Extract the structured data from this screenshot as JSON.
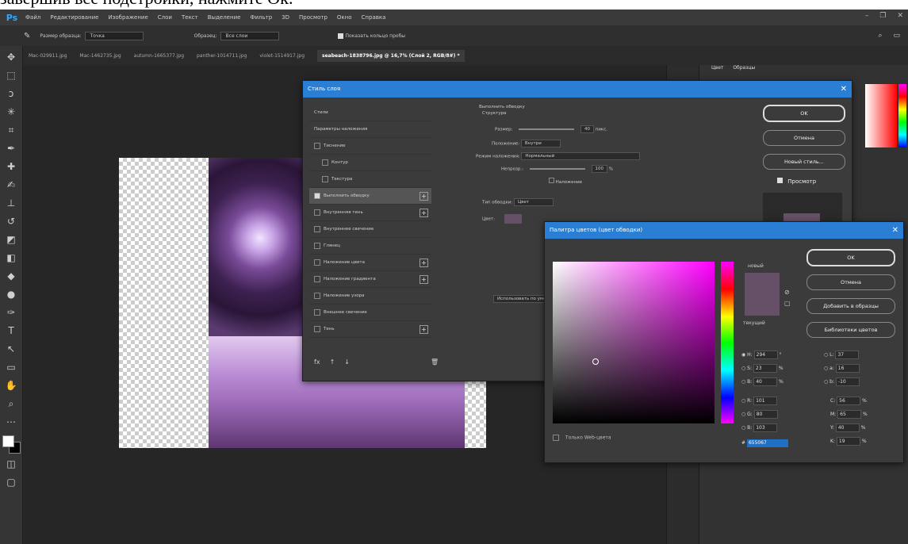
{
  "caption": {
    "text": "завершив все подстройки, нажмите Ok."
  },
  "app": {
    "logo": "Ps",
    "menu": [
      "Файл",
      "Редактирование",
      "Изображение",
      "Слои",
      "Текст",
      "Выделение",
      "Фильтр",
      "3D",
      "Просмотр",
      "Окно",
      "Справка"
    ]
  },
  "options": {
    "sample_label": "Размер образца:",
    "sample_value": "Точка",
    "sample_from_label": "Образец:",
    "sample_from_value": "Все слои",
    "show_ring": "Показать кольцо пробы"
  },
  "tabs": [
    {
      "label": "Mac-029911.jpg"
    },
    {
      "label": "Mac-1462735.jpg"
    },
    {
      "label": "autumn-1665377.jpg"
    },
    {
      "label": "panther-1014711.jpg"
    },
    {
      "label": "violet-1514917.jpg"
    },
    {
      "label": "seabeach-1838796.jpg @ 16,7% (Слой 2, RGB/8#) *",
      "active": true
    }
  ],
  "right_panel": {
    "tabs": [
      "Цвет",
      "Образцы"
    ]
  },
  "layer_style": {
    "title": "Стиль слоя",
    "items": [
      {
        "label": "Стили",
        "check": false,
        "plus": false
      },
      {
        "label": "Параметры наложения",
        "check": false,
        "plus": false
      },
      {
        "label": "Тиснение",
        "check": true,
        "plus": false
      },
      {
        "label": "Контур",
        "check": true,
        "plus": false
      },
      {
        "label": "Текстура",
        "check": true,
        "plus": false
      },
      {
        "label": "Выполнить обводку",
        "check": true,
        "checked": true,
        "plus": true,
        "active": true
      },
      {
        "label": "Внутренняя тень",
        "check": true,
        "plus": true
      },
      {
        "label": "Внутреннее свечение",
        "check": true,
        "plus": false
      },
      {
        "label": "Глянец",
        "check": true,
        "plus": false
      },
      {
        "label": "Наложение цвета",
        "check": true,
        "plus": true
      },
      {
        "label": "Наложение градиента",
        "check": true,
        "plus": true
      },
      {
        "label": "Наложение узора",
        "check": true,
        "plus": false
      },
      {
        "label": "Внешнее свечение",
        "check": true,
        "plus": false
      },
      {
        "label": "Тень",
        "check": true,
        "plus": true
      }
    ],
    "section_title": "Выполнить обводку",
    "structure": "Структура",
    "size_label": "Размер:",
    "size_value": "40",
    "size_unit": "пикс.",
    "position_label": "Положение:",
    "position_value": "Внутри",
    "blend_label": "Режим наложения:",
    "blend_value": "Нормальный",
    "opacity_label": "Непрозр.:",
    "opacity_value": "100",
    "opacity_unit": "%",
    "overprint": "Наложение",
    "fill_type_label": "Тип обводки:",
    "fill_type_value": "Цвет",
    "color_label": "Цвет:",
    "use_default": "Использовать по умолчанию",
    "buttons": {
      "ok": "OK",
      "cancel": "Отмена",
      "new_style": "Новый стиль...",
      "preview": "Просмотр"
    }
  },
  "picker": {
    "title": "Палитра цветов (цвет обводки)",
    "new_label": "новый",
    "current_label": "текущий",
    "buttons": {
      "ok": "OK",
      "cancel": "Отмена",
      "add": "Добавить в образцы",
      "libraries": "Библиотеки цветов"
    },
    "web_only": "Только Web-цвета",
    "hsb": [
      {
        "k": "H:",
        "v": "294",
        "u": "°"
      },
      {
        "k": "S:",
        "v": "23",
        "u": "%"
      },
      {
        "k": "B:",
        "v": "40",
        "u": "%"
      }
    ],
    "rgb": [
      {
        "k": "R:",
        "v": "101"
      },
      {
        "k": "G:",
        "v": "80"
      },
      {
        "k": "B:",
        "v": "103"
      }
    ],
    "lab": [
      {
        "k": "L:",
        "v": "37"
      },
      {
        "k": "a:",
        "v": "16"
      },
      {
        "k": "b:",
        "v": "-10"
      }
    ],
    "cmyk": [
      {
        "k": "C:",
        "v": "56",
        "u": "%"
      },
      {
        "k": "M:",
        "v": "65",
        "u": "%"
      },
      {
        "k": "Y:",
        "v": "40",
        "u": "%"
      },
      {
        "k": "K:",
        "v": "19",
        "u": "%"
      }
    ],
    "hex_label": "#",
    "hex": "655067",
    "swatch_color": "#655067"
  }
}
